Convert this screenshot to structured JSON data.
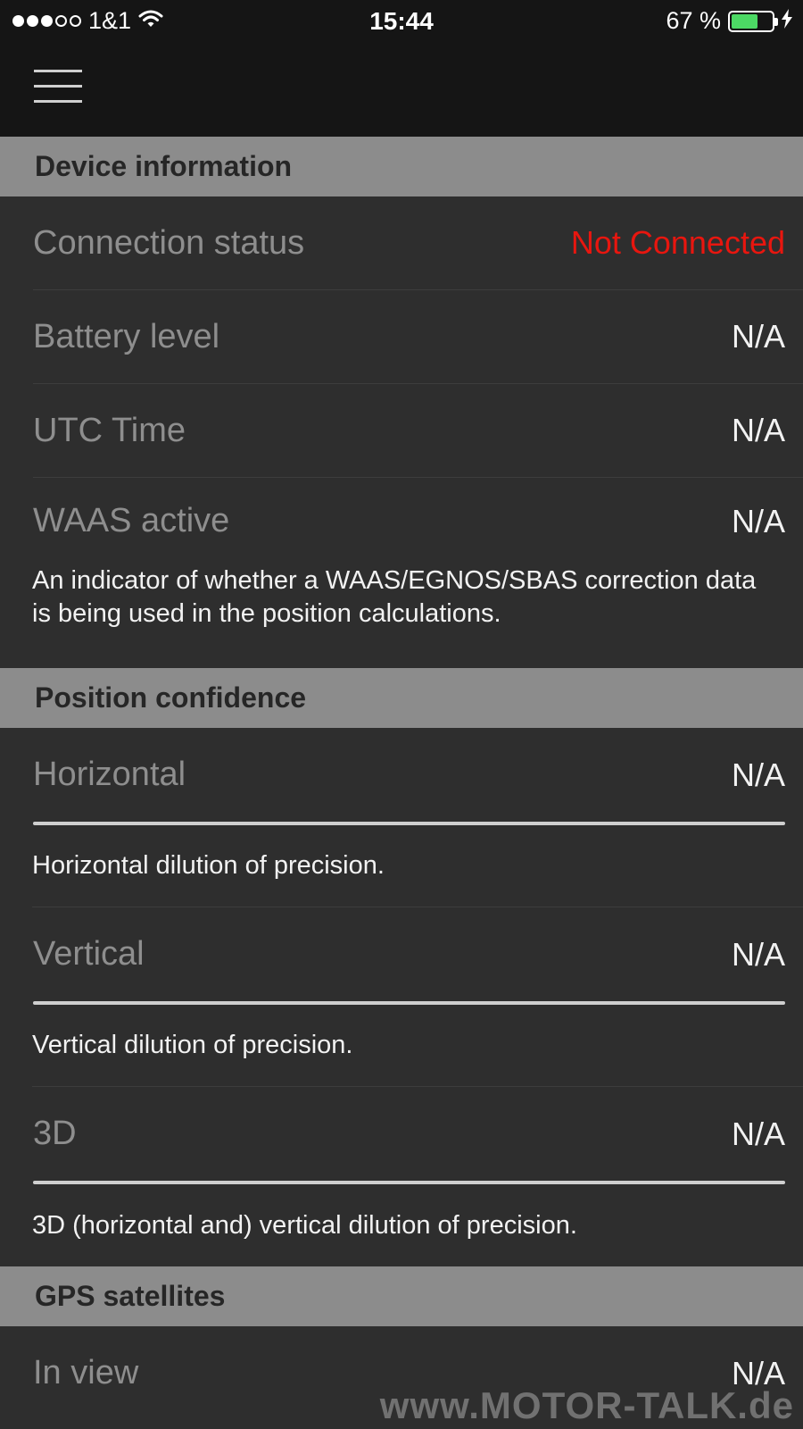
{
  "status_bar": {
    "carrier": "1&1",
    "time": "15:44",
    "battery_percent": "67 %",
    "battery_level": 0.67,
    "signal_strength": 3,
    "signal_max": 5
  },
  "colors": {
    "alert": "#e8160f",
    "battery": "#4cd964",
    "section_header_bg": "#8c8c8c"
  },
  "sections": {
    "device": {
      "title": "Device information",
      "connection_status": {
        "label": "Connection status",
        "value": "Not Connected"
      },
      "battery_level": {
        "label": "Battery level",
        "value": "N/A"
      },
      "utc_time": {
        "label": "UTC Time",
        "value": "N/A"
      },
      "waas_active": {
        "label": "WAAS active",
        "value": "N/A",
        "description": "An indicator of whether a WAAS/EGNOS/SBAS correction data is being used in the position calculations."
      }
    },
    "position": {
      "title": "Position confidence",
      "horizontal": {
        "label": "Horizontal",
        "value": "N/A",
        "description": "Horizontal dilution of precision."
      },
      "vertical": {
        "label": "Vertical",
        "value": "N/A",
        "description": "Vertical dilution of precision."
      },
      "three_d": {
        "label": "3D",
        "value": "N/A",
        "description": "3D (horizontal and) vertical dilution of precision."
      }
    },
    "gps": {
      "title": "GPS satellites",
      "in_view": {
        "label": "In view",
        "value": "N/A"
      }
    }
  },
  "watermark": "www.MOTOR-TALK.de"
}
